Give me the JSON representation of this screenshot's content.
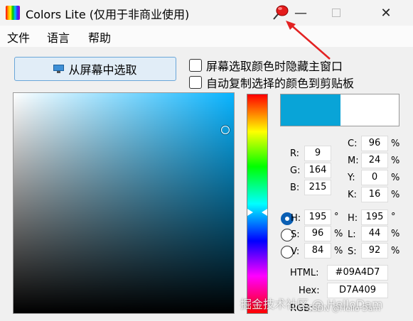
{
  "titlebar": {
    "title": "Colors Lite (仅用于非商业使用)",
    "pin_icon": "pushpin-icon",
    "min_label": "—",
    "close_label": "✕"
  },
  "menu": {
    "items": [
      "文件",
      "语言",
      "帮助"
    ]
  },
  "pick_button": {
    "label": "从屏幕中选取",
    "icon": "monitor-icon"
  },
  "options": {
    "hide_window": "屏幕选取颜色时隐藏主窗口",
    "auto_copy": "自动复制选择的颜色到剪贴板"
  },
  "colors": {
    "current": "#09A4D7",
    "previous": "#FFFFFF",
    "picker_hue": "#09B4FF",
    "accent": "#0A5FB4"
  },
  "rgb": {
    "r_label": "R:",
    "r": "9",
    "g_label": "G:",
    "g": "164",
    "b_label": "B:",
    "b": "215"
  },
  "cmyk": {
    "c_label": "C:",
    "c": "96",
    "m_label": "M:",
    "m": "24",
    "y_label": "Y:",
    "y": "0",
    "k_label": "K:",
    "k": "16",
    "unit": "%"
  },
  "hsv": {
    "h_label": "H:",
    "h": "195",
    "h_unit": "°",
    "s_label": "S:",
    "s": "96",
    "s_unit": "%",
    "v_label": "V:",
    "v": "84",
    "v_unit": "%"
  },
  "hsl": {
    "h_label": "H:",
    "h": "195",
    "h_unit": "°",
    "l_label": "L:",
    "l": "44",
    "l_unit": "%",
    "s_label": "S:",
    "s": "92",
    "s_unit": "%"
  },
  "codes": {
    "html_label": "HTML:",
    "html": "#09A4D7",
    "hex_label": "Hex:",
    "hex": "D7A409",
    "rgb_label": "RGB:"
  },
  "watermark": {
    "main": "掘金技术社区 @ HelloDam",
    "sub": "CSDN @Hello Dam"
  }
}
